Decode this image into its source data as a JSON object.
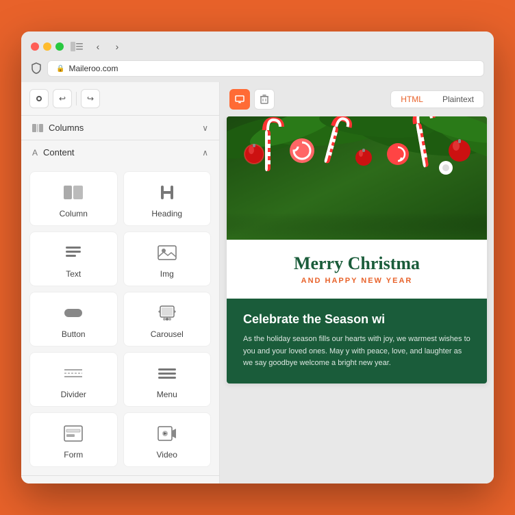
{
  "browser": {
    "url": "Maileroo.com",
    "traffic_lights": [
      "red",
      "yellow",
      "green"
    ]
  },
  "toolbar": {
    "undo_label": "↩",
    "redo_label": "↪"
  },
  "sidebar": {
    "columns_label": "Columns",
    "content_label": "Content",
    "columns_collapsed": true,
    "content_expanded": true
  },
  "content_items": [
    {
      "id": "column",
      "label": "Column",
      "icon": "column"
    },
    {
      "id": "heading",
      "label": "Heading",
      "icon": "heading"
    },
    {
      "id": "text",
      "label": "Text",
      "icon": "text"
    },
    {
      "id": "img",
      "label": "Img",
      "icon": "img"
    },
    {
      "id": "button",
      "label": "Button",
      "icon": "button"
    },
    {
      "id": "carousel",
      "label": "Carousel",
      "icon": "carousel"
    },
    {
      "id": "divider",
      "label": "Divider",
      "icon": "divider"
    },
    {
      "id": "menu",
      "label": "Menu",
      "icon": "menu"
    },
    {
      "id": "form",
      "label": "Form",
      "icon": "form"
    },
    {
      "id": "video",
      "label": "Video",
      "icon": "video"
    }
  ],
  "main_toolbar": {
    "html_label": "HTML",
    "plaintext_label": "Plaintext",
    "active_view": "HTML"
  },
  "email_preview": {
    "merry_christmas": "Merry Christma",
    "happy_new_year": "AND HAPPY NEW YEAR",
    "celebrate_heading": "Celebrate the Season wi",
    "body_text": "As the holiday season fills our hearts with joy, we warmest wishes to you and your loved ones. May y with peace, love, and laughter as we say goodbye welcome a bright new year."
  }
}
